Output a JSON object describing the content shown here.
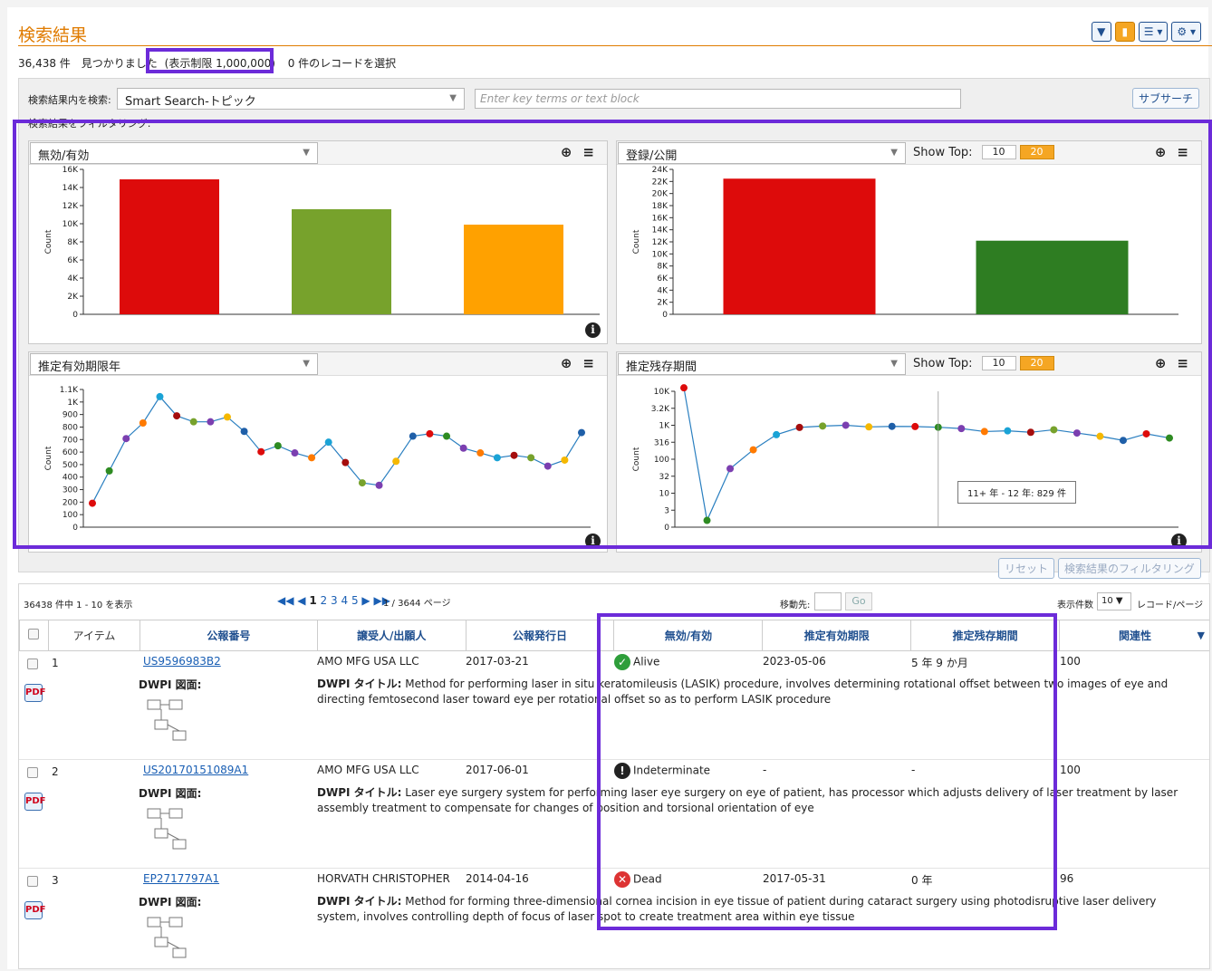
{
  "header": {
    "title": "検索結果",
    "count_text": "36,438 件　見つかりました",
    "limit_text": "(表示制限 1,000,000)",
    "selected_text": "0 件のレコードを選択",
    "toolbar_icons": [
      "filter-icon",
      "chart-icon",
      "list-icon",
      "gear-icon"
    ]
  },
  "filter": {
    "search_within_label": "検索結果内を検索:",
    "search_mode_value": "Smart Search-トピック",
    "search_placeholder": "Enter key terms or text block",
    "subsearch_button": "サブサーチ",
    "filtering_label": "検索結果をフィルタリング:",
    "reset_button": "リセット",
    "filter_button": "検索結果のフィルタリング"
  },
  "charts": {
    "ylabel": "Count",
    "show_top_label": "Show Top:",
    "show_top_options": [
      "10",
      "20"
    ],
    "chart1_select": "無効/有効",
    "chart2_select": "登録/公開",
    "chart3_select": "推定有効期限年",
    "chart4_select": "推定残存期間",
    "tooltip": "11+ 年 - 12 年: 829 件"
  },
  "chart_data": [
    {
      "type": "bar",
      "title": "無効/有効",
      "ylabel": "Count",
      "categories": [
        "",
        "",
        ""
      ],
      "values": [
        14900,
        11600,
        9900
      ],
      "colors": [
        "#dd0b0b",
        "#77a22c",
        "#ffa100"
      ],
      "ylim": [
        0,
        16000
      ],
      "yticks": [
        "0",
        "2K",
        "4K",
        "6K",
        "8K",
        "10K",
        "12K",
        "14K",
        "16K"
      ]
    },
    {
      "type": "bar",
      "title": "登録/公開",
      "ylabel": "Count",
      "categories": [
        "",
        ""
      ],
      "values": [
        23400,
        12700
      ],
      "colors": [
        "#dd0b0b",
        "#2e7d22"
      ],
      "ylim": [
        0,
        25000
      ],
      "yticks": [
        "0",
        "2K",
        "4K",
        "6K",
        "8K",
        "10K",
        "12K",
        "14K",
        "16K",
        "18K",
        "20K",
        "22K",
        "24K"
      ]
    },
    {
      "type": "line",
      "title": "推定有効期限年",
      "ylabel": "Count",
      "values": [
        200,
        470,
        740,
        870,
        1090,
        930,
        880,
        880,
        920,
        800,
        630,
        680,
        620,
        580,
        710,
        540,
        370,
        350,
        550,
        760,
        780,
        760,
        660,
        620,
        580,
        600,
        580,
        510,
        560,
        790
      ],
      "point_colors": [
        "#dd0b0b",
        "#2e8b22",
        "#7b3fb0",
        "#ff7a00",
        "#1aa3d6",
        "#a50d0d",
        "#77a22c",
        "#7b3fb0",
        "#f5b800",
        "#1f5fa8",
        "#dd0b0b",
        "#2e8b22",
        "#7b3fb0",
        "#ff7a00",
        "#1aa3d6",
        "#a50d0d",
        "#77a22c",
        "#7b3fb0",
        "#f5b800",
        "#1f5fa8",
        "#dd0b0b",
        "#2e8b22",
        "#7b3fb0",
        "#ff7a00",
        "#1aa3d6",
        "#a50d0d",
        "#77a22c",
        "#7b3fb0",
        "#f5b800",
        "#1f5fa8"
      ],
      "yticks": [
        "0",
        "100",
        "200",
        "300",
        "400",
        "500",
        "600",
        "700",
        "800",
        "900",
        "1K",
        "1.1K"
      ],
      "ylim": [
        0,
        1150
      ]
    },
    {
      "type": "line",
      "title": "推定残存期間",
      "ylabel": "Count",
      "scale": "log",
      "values": [
        12000,
        1.5,
        50,
        180,
        500,
        820,
        900,
        950,
        850,
        880,
        870,
        829,
        760,
        620,
        650,
        590,
        700,
        560,
        450,
        340,
        530,
        400
      ],
      "point_colors": [
        "#dd0b0b",
        "#2e8b22",
        "#7b3fb0",
        "#ff7a00",
        "#1aa3d6",
        "#a50d0d",
        "#77a22c",
        "#7b3fb0",
        "#f5b800",
        "#1f5fa8",
        "#dd0b0b",
        "#2e8b22",
        "#7b3fb0",
        "#ff7a00",
        "#1aa3d6",
        "#a50d0d",
        "#77a22c",
        "#7b3fb0",
        "#f5b800",
        "#1f5fa8",
        "#dd0b0b",
        "#2e8b22"
      ],
      "yticks": [
        "0",
        "3",
        "10",
        "32",
        "100",
        "316",
        "1K",
        "3.2K",
        "10K"
      ]
    }
  ],
  "results": {
    "range_text": "36438 件中 1 - 10 を表示",
    "pages": [
      "1",
      "2",
      "3",
      "4",
      "5"
    ],
    "page_info": "1 / 3644 ページ",
    "goto_label": "移動先:",
    "go_button": "Go",
    "per_page_label": "表示件数",
    "per_page_value": "10",
    "per_page_suffix": "レコード/ページ",
    "columns": [
      "アイテム",
      "公報番号",
      "譲受人/出願人",
      "公報発行日",
      "無効/有効",
      "推定有効期限",
      "推定残存期間",
      "関連性"
    ],
    "dwpi_image_label": "DWPI 図面:",
    "dwpi_title_label": "DWPI タイトル:",
    "rows": [
      {
        "item": "1",
        "pub": "US9596983B2",
        "assignee": "AMO MFG USA LLC",
        "date": "2017-03-21",
        "status": "Alive",
        "expiry": "2023-05-06",
        "remaining": "5 年 9 か月",
        "relevance": "100",
        "title": "Method for performing laser in situ keratomileusis (LASIK) procedure, involves determining rotational offset between two images of eye and directing femtosecond laser toward eye per rotational offset so as to perform LASIK procedure"
      },
      {
        "item": "2",
        "pub": "US20170151089A1",
        "assignee": "AMO MFG USA LLC",
        "date": "2017-06-01",
        "status": "Indeterminate",
        "expiry": "-",
        "remaining": "-",
        "relevance": "100",
        "title": "Laser eye surgery system for performing laser eye surgery on eye of patient, has processor which adjusts delivery of laser treatment by laser assembly treatment to compensate for changes of position and torsional orientation of eye"
      },
      {
        "item": "3",
        "pub": "EP2717797A1",
        "assignee": "HORVATH CHRISTOPHER",
        "date": "2014-04-16",
        "status": "Dead",
        "expiry": "2017-05-31",
        "remaining": "0 年",
        "relevance": "96",
        "title": "Method for forming three-dimensional cornea incision in eye tissue of patient during cataract surgery using photodisruptive laser delivery system, involves controlling depth of focus of laser spot to create treatment area within eye tissue"
      }
    ]
  }
}
